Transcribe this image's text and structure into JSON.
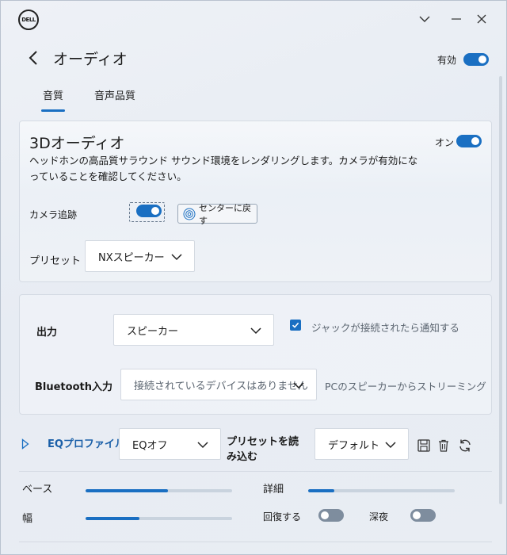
{
  "window": {
    "logo_text": "DELL"
  },
  "header": {
    "title": "オーディオ",
    "enabled_label": "有効",
    "enabled": true
  },
  "tabs": [
    {
      "label": "音質",
      "active": true
    },
    {
      "label": "音声品質",
      "active": false
    }
  ],
  "audio3d": {
    "title": "3Dオーディオ",
    "state_label": "オン",
    "enabled": true,
    "description": "ヘッドホンの高品質サラウンド サウンド環境をレンダリングします。カメラが有効になっていることを確認してください。",
    "camera_tracking_label": "カメラ追跡",
    "camera_tracking_enabled": true,
    "center_button_label": "センターに戻す",
    "preset_label": "プリセット",
    "preset_value": "NXスピーカー"
  },
  "output": {
    "label": "出力",
    "value": "スピーカー",
    "notify_checked": true,
    "notify_label": "ジャックが接続されたら通知する",
    "bluetooth_label": "Bluetooth入力",
    "bluetooth_value": "接続されているデバイスはありません",
    "streaming_label": "PCのスピーカーからストリーミング"
  },
  "eq": {
    "profile_label": "EQプロファイル",
    "profile_value": "EQオフ",
    "load_preset_label": "プリセットを読み込む",
    "preset_value": "デフォルト",
    "icons": [
      "save-icon",
      "trash-icon",
      "refresh-icon"
    ]
  },
  "sliders": {
    "bass_label": "ベース",
    "bass_level": 0.56,
    "detail_label": "詳細",
    "detail_level": 0.18,
    "width_label": "幅",
    "width_level": 0.37,
    "restore_label": "回復する",
    "restore_enabled": false,
    "night_label": "深夜",
    "night_enabled": false
  },
  "colors": {
    "accent": "#1a6fc2",
    "toggle_off": "#7e8d9e"
  }
}
